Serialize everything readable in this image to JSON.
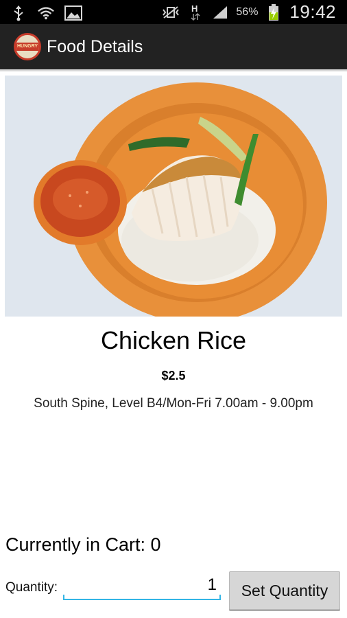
{
  "status_bar": {
    "battery_percent": "56%",
    "time": "19:42",
    "network_type": "H",
    "icons": [
      "usb-icon",
      "wifi-question-icon",
      "image-icon",
      "vibrate-off-icon",
      "data-arrows-icon",
      "signal-icon",
      "battery-charging-icon"
    ]
  },
  "action_bar": {
    "title": "Food Details",
    "logo_text": "HUNGRY"
  },
  "food": {
    "name": "Chicken Rice",
    "price": "$2.5",
    "location": "South Spine, Level B4/Mon-Fri 7.00am - 9.00pm"
  },
  "cart": {
    "label": "Currently in Cart: 0"
  },
  "quantity": {
    "label": "Quantity:",
    "value": "1",
    "button_label": "Set Quantity"
  },
  "colors": {
    "status_bar_bg": "#000000",
    "action_bar_bg": "#222222",
    "input_underline": "#33b5e5",
    "button_bg": "#d6d6d6",
    "plate": "#e8903a"
  }
}
